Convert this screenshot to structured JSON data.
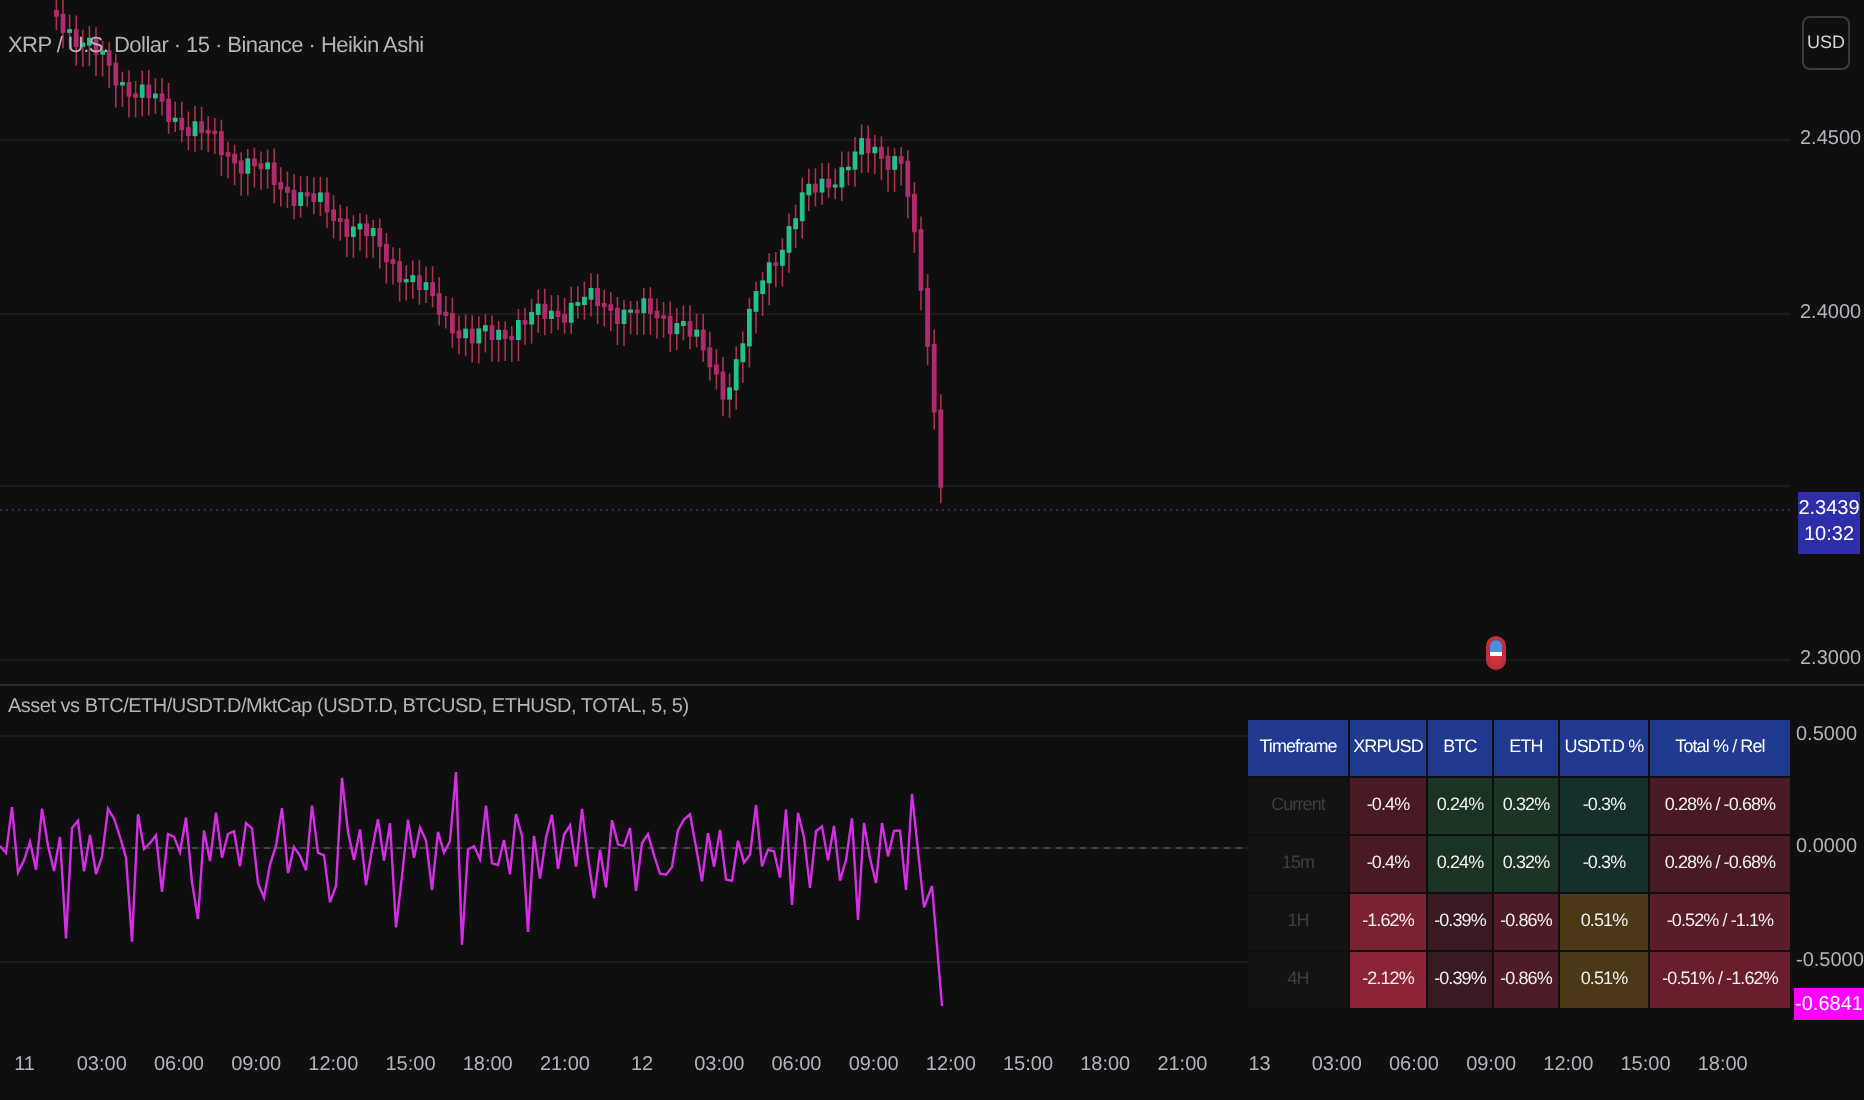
{
  "chart": {
    "title": "XRP / U.S. Dollar · 15 · Binance · Heikin Ashi",
    "currency_button": "USD",
    "price_axis": [
      "2.4500",
      "2.4000",
      "2.3000"
    ],
    "last_price": "2.3439",
    "countdown": "10:32"
  },
  "indicator": {
    "title": "Asset vs BTC/ETH/USDT.D/MktCap (USDT.D, BTCUSD, ETHUSD, TOTAL, 5, 5)",
    "axis": [
      "0.5000",
      "0.0000",
      "-0.5000"
    ],
    "last_value": "-0.6841",
    "table": {
      "columns": [
        "Timeframe",
        "XRPUSD",
        "BTC",
        "ETH",
        "USDT.D %",
        "Total % / Rel"
      ],
      "rows": [
        {
          "cells": [
            {
              "text": "Current",
              "color": "#131313"
            },
            {
              "text": "-0.4%",
              "color": "#4a1a24"
            },
            {
              "text": "0.24%",
              "color": "#1a3322"
            },
            {
              "text": "0.32%",
              "color": "#1c3424"
            },
            {
              "text": "-0.3%",
              "color": "#15302a"
            },
            {
              "text": "0.28% / -0.68%",
              "color": "#4a1a24"
            }
          ]
        },
        {
          "cells": [
            {
              "text": "15m",
              "color": "#131313"
            },
            {
              "text": "-0.4%",
              "color": "#4a1a24"
            },
            {
              "text": "0.24%",
              "color": "#1a3322"
            },
            {
              "text": "0.32%",
              "color": "#1c3424"
            },
            {
              "text": "-0.3%",
              "color": "#15302a"
            },
            {
              "text": "0.28% / -0.68%",
              "color": "#4a1a24"
            }
          ]
        },
        {
          "cells": [
            {
              "text": "1H",
              "color": "#131313"
            },
            {
              "text": "-1.62%",
              "color": "#7a2232"
            },
            {
              "text": "-0.39%",
              "color": "#3a1a22"
            },
            {
              "text": "-0.86%",
              "color": "#4e1c28"
            },
            {
              "text": "0.51%",
              "color": "#4a3816"
            },
            {
              "text": "-0.52% / -1.1%",
              "color": "#5a1c28"
            }
          ]
        },
        {
          "cells": [
            {
              "text": "4H",
              "color": "#131313"
            },
            {
              "text": "-2.12%",
              "color": "#8a2436"
            },
            {
              "text": "-0.39%",
              "color": "#3a1a22"
            },
            {
              "text": "-0.86%",
              "color": "#4e1c28"
            },
            {
              "text": "0.51%",
              "color": "#4a3816"
            },
            {
              "text": "-0.51% / -1.62%",
              "color": "#6a1e2c"
            }
          ]
        }
      ]
    }
  },
  "time_axis": [
    "11",
    "03:00",
    "06:00",
    "09:00",
    "12:00",
    "15:00",
    "18:00",
    "21:00",
    "12",
    "03:00",
    "06:00",
    "09:00",
    "12:00",
    "15:00",
    "18:00",
    "21:00",
    "13",
    "03:00",
    "06:00",
    "09:00",
    "12:00",
    "15:00",
    "18:00"
  ]
}
